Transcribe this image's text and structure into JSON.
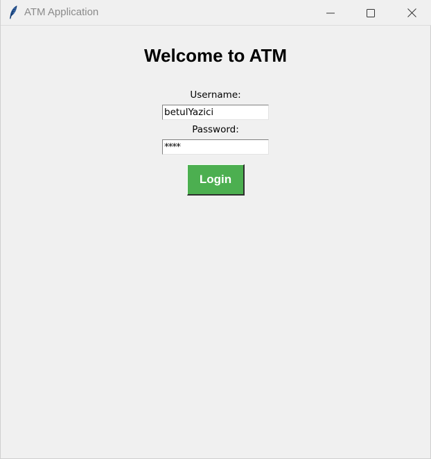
{
  "window": {
    "title": "ATM Application",
    "icon": "feather-icon",
    "controls": [
      "minimize-icon",
      "maximize-icon",
      "close-icon"
    ]
  },
  "main": {
    "heading": "Welcome to ATM",
    "username_label": "Username:",
    "username_value": "betulYazici",
    "password_label": "Password:",
    "password_value": "****",
    "login_label": "Login"
  },
  "colors": {
    "background": "#f0f0f0",
    "login_button": "#4caf50",
    "login_text": "#ffffff"
  }
}
